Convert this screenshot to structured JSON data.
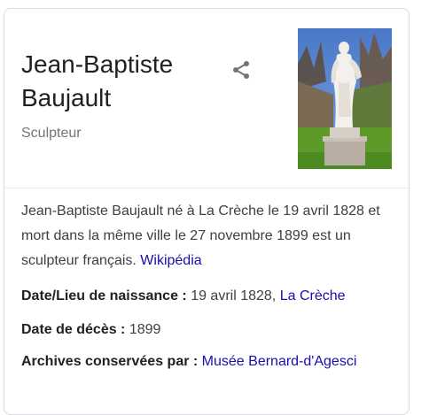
{
  "panel": {
    "title": "Jean-Baptiste Baujault",
    "subtitle": "Sculpteur",
    "share_icon": "share-icon",
    "image_icon": "statue-photo"
  },
  "description": {
    "text": "Jean-Baptiste Baujault né à La Crèche le 19 avril 1828 et mort dans la même ville le 27 novembre 1899 est un sculpteur français.",
    "source_link": "Wikipédia"
  },
  "facts": [
    {
      "label": "Date/Lieu de naissance :",
      "value": "19 avril 1828,",
      "link": "La Crèche"
    },
    {
      "label": "Date de décès :",
      "value": "1899",
      "link": ""
    },
    {
      "label": "Archives conservées par :",
      "value": "",
      "link": "Musée Bernard-d'Agesci"
    }
  ],
  "colors": {
    "link": "#1a0dab",
    "text": "#3c4043",
    "title": "#202124",
    "muted": "#70757a",
    "border": "#dadce0"
  }
}
